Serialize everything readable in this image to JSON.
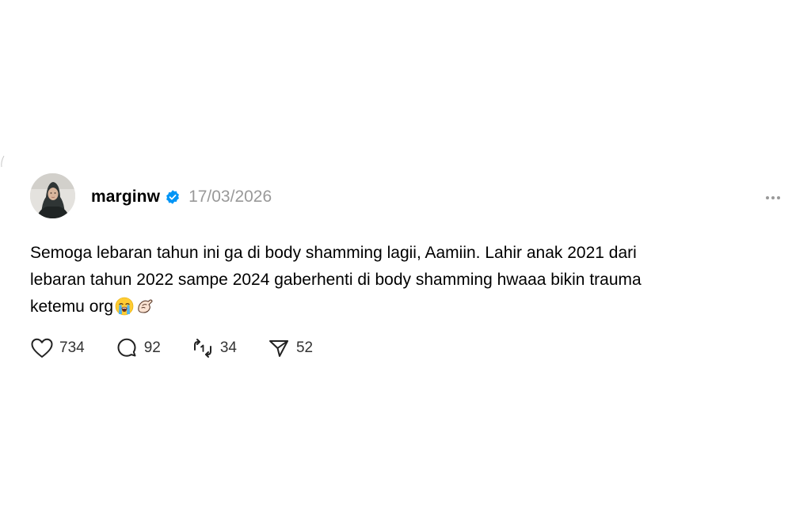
{
  "post": {
    "username": "marginw",
    "verified_icon": "verified-badge-icon",
    "timestamp": "17/03/2026",
    "body_lines": [
      "Semoga lebaran tahun ini ga di body shamming lagii, Aamiin. Lahir anak 2021 dari",
      "lebaran tahun 2022 sampe 2024 gaberhenti di body shamming hwaaa bikin trauma",
      "ketemu org"
    ],
    "body_emojis": [
      "loudly-crying-face-emoji",
      "pinching-hand-emoji"
    ],
    "actions": {
      "like_count": "734",
      "comment_count": "92",
      "repost_count": "34",
      "share_count": "52"
    }
  },
  "colors": {
    "background": "#ffffff",
    "text": "#000000",
    "muted": "#999999",
    "verified": "#0095f6"
  }
}
